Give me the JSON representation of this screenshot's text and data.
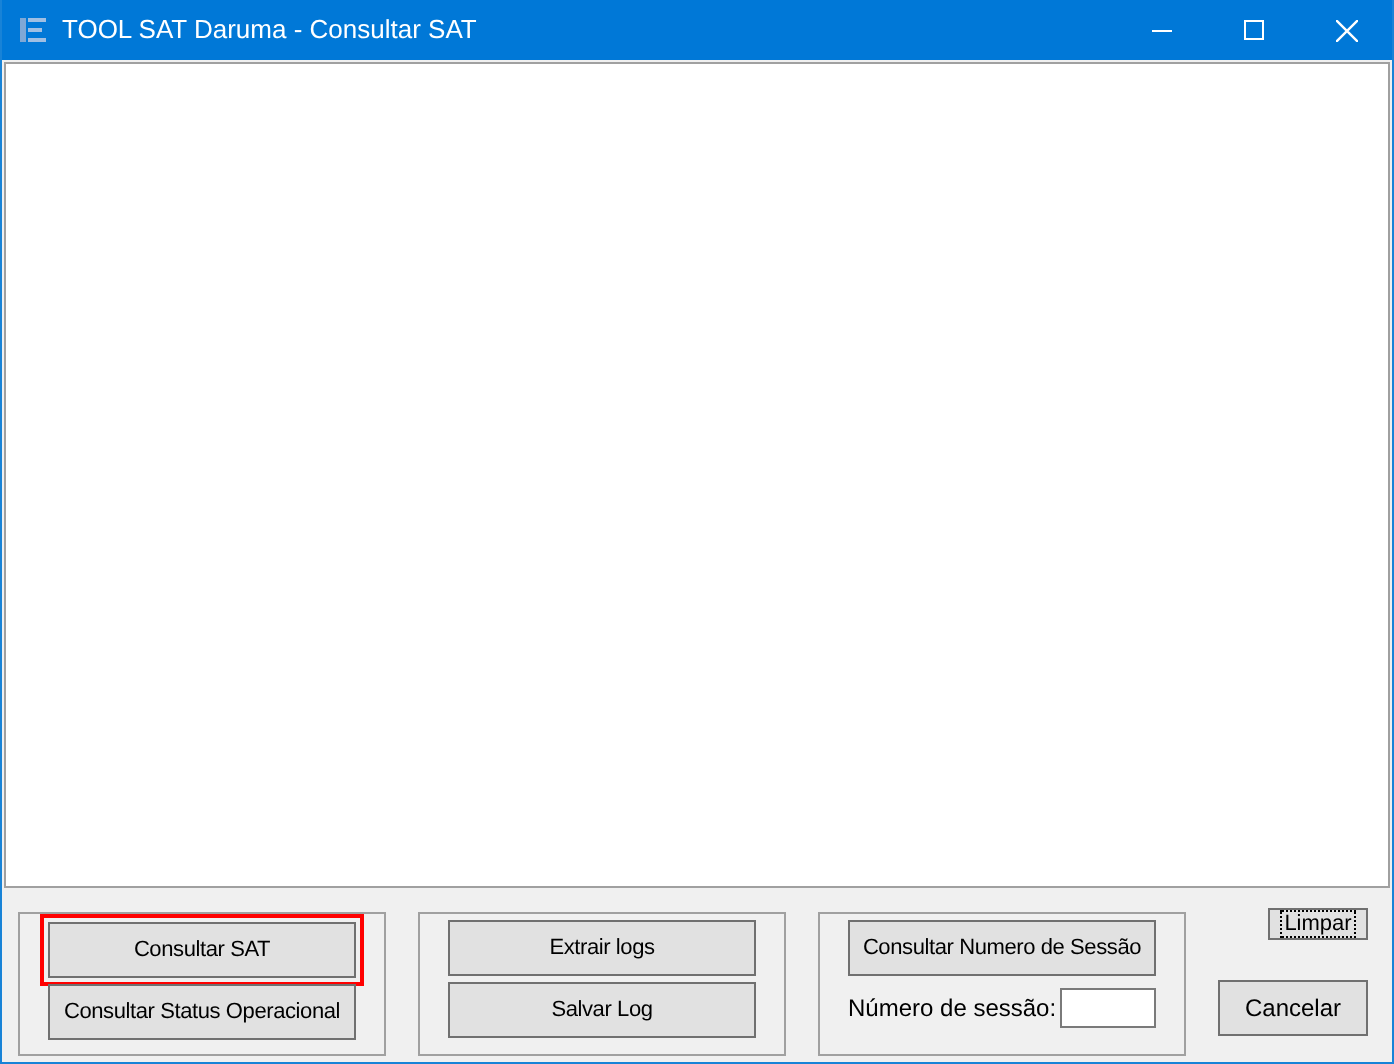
{
  "window": {
    "title": "TOOL SAT Daruma - Consultar SAT"
  },
  "groups": [
    {
      "buttons": [
        {
          "label": "Consultar SAT",
          "highlighted": true
        },
        {
          "label": "Consultar Status Operacional",
          "highlighted": false
        }
      ]
    },
    {
      "buttons": [
        {
          "label": "Extrair logs",
          "highlighted": false
        },
        {
          "label": "Salvar Log",
          "highlighted": false
        }
      ]
    },
    {
      "buttons": [
        {
          "label": "Consultar Numero de Sessão",
          "highlighted": false
        }
      ],
      "field": {
        "label": "Número de sessão:"
      }
    }
  ],
  "limpar": {
    "label": "Limpar",
    "focused": true
  },
  "cancel": {
    "label": "Cancelar"
  }
}
